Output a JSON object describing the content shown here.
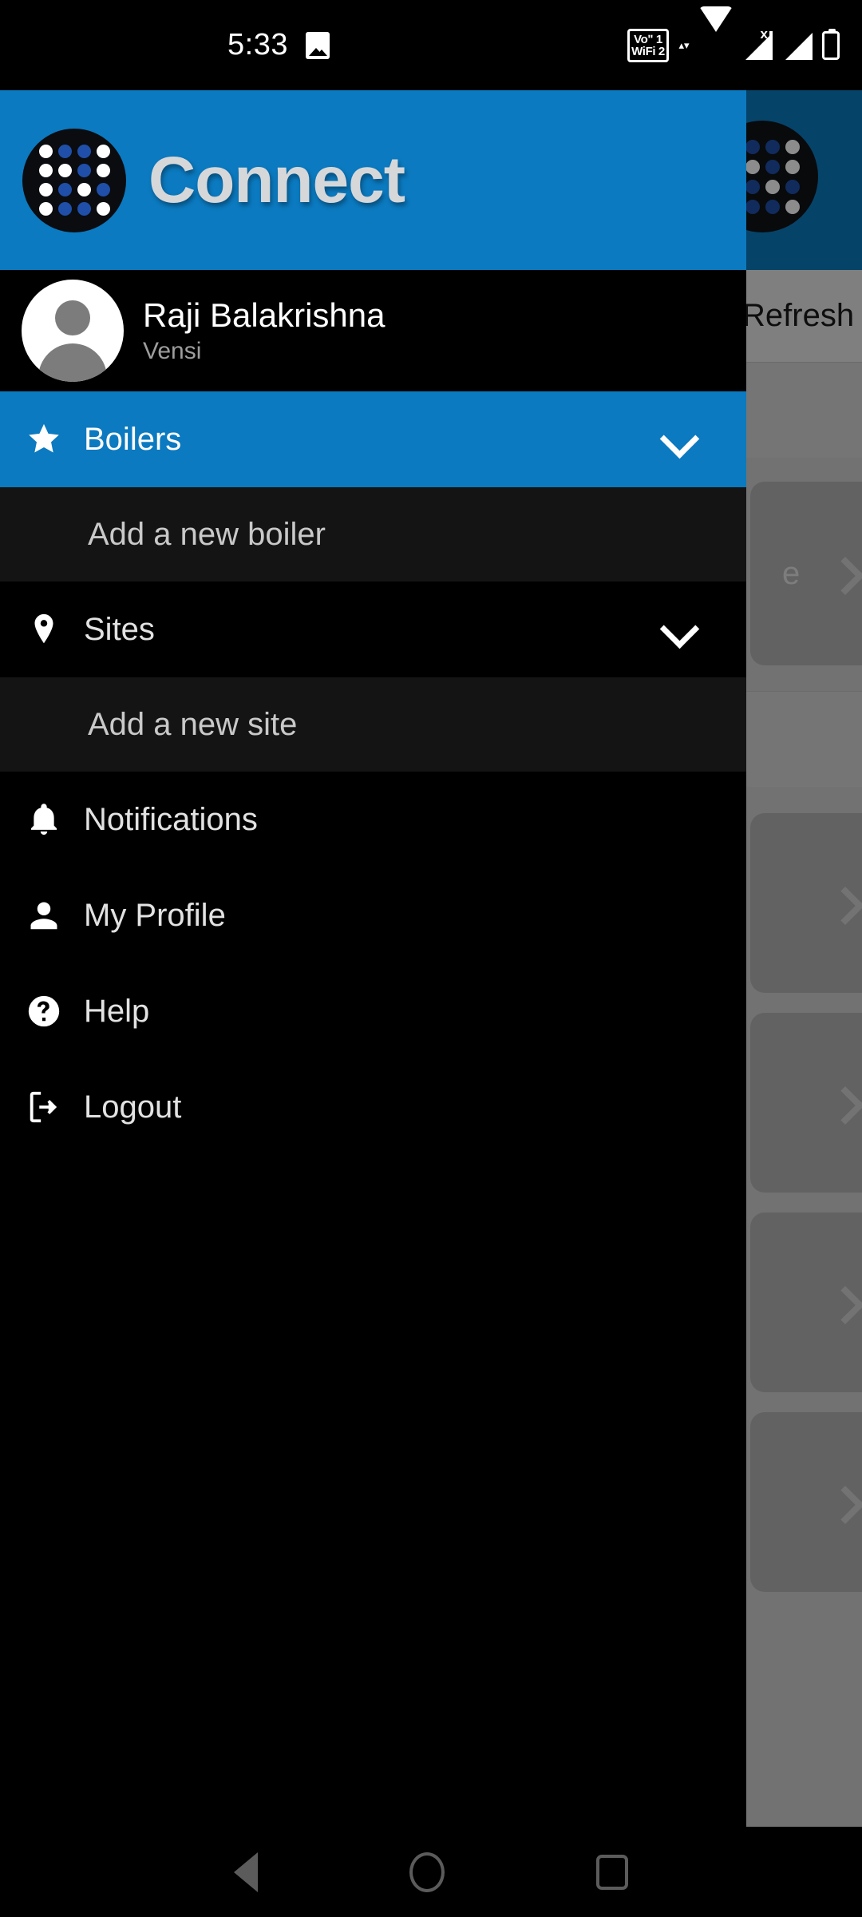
{
  "status_bar": {
    "time": "5:33",
    "icons": [
      {
        "name": "photo-icon"
      },
      {
        "name": "volte-wifi-icon",
        "line1": "Voʺ 1",
        "line2": "WiFi 2"
      },
      {
        "name": "wifi-icon"
      },
      {
        "name": "signal-1-icon"
      },
      {
        "name": "signal-2-icon"
      },
      {
        "name": "battery-icon"
      }
    ]
  },
  "drawer": {
    "header": {
      "title": "Connect",
      "logo_name": "connect-logo"
    },
    "profile": {
      "name": "Raji Balakrishna",
      "organization": "Vensi",
      "avatar_name": "user-avatar"
    },
    "items": [
      {
        "label": "Boilers",
        "icon": "star-icon",
        "active": true,
        "sub": false,
        "chevron": true
      },
      {
        "label": "Add a new boiler",
        "icon": "",
        "active": false,
        "sub": true,
        "chevron": false
      },
      {
        "label": "Sites",
        "icon": "map-pin-icon",
        "active": false,
        "sub": false,
        "chevron": true
      },
      {
        "label": "Add a new site",
        "icon": "",
        "active": false,
        "sub": true,
        "chevron": false
      },
      {
        "label": "Notifications",
        "icon": "bell-icon",
        "active": false,
        "sub": false,
        "chevron": false
      },
      {
        "label": "My Profile",
        "icon": "person-icon",
        "active": false,
        "sub": false,
        "chevron": false
      },
      {
        "label": "Help",
        "icon": "help-icon",
        "active": false,
        "sub": false,
        "chevron": false
      },
      {
        "label": "Logout",
        "icon": "logout-icon",
        "active": false,
        "sub": false,
        "chevron": false
      }
    ]
  },
  "background_app": {
    "refresh_label": "Refresh",
    "partial_card_label": "e",
    "rows": [
      {
        "type": "collapsible",
        "chevron": "down"
      },
      {
        "type": "card",
        "chevron": "right"
      },
      {
        "type": "collapsible",
        "chevron": "down"
      },
      {
        "type": "card",
        "chevron": "right"
      },
      {
        "type": "card",
        "chevron": "right"
      },
      {
        "type": "card",
        "chevron": "right"
      }
    ]
  },
  "nav_bar": {
    "back": "back-button",
    "home": "home-button",
    "recents": "recents-button"
  },
  "colors": {
    "brand_blue": "#0b7ac0",
    "drawer_bg": "#000000",
    "submenu_bg": "#141414",
    "label": "#e2e2e2",
    "muted": "#9d9d9d",
    "logo_dot_blue": "#1f4fa8",
    "logo_dot_white": "#ffffff"
  }
}
